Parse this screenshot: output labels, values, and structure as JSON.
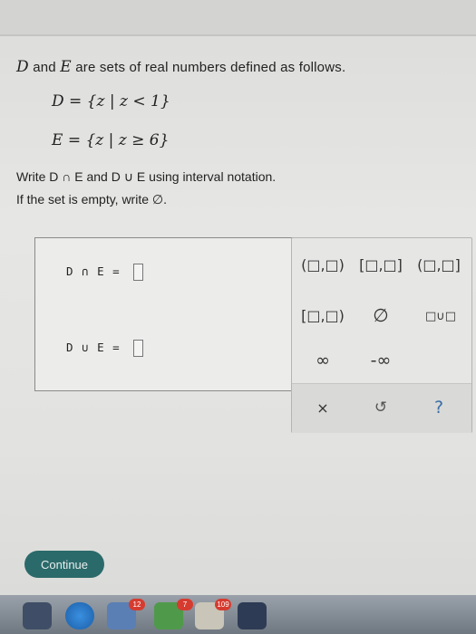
{
  "problem": {
    "intro_set1": "D",
    "intro_and": " and ",
    "intro_set2": "E",
    "intro_rest": " are sets of real numbers defined as follows.",
    "set_d": "D = {z | z < 1}",
    "set_e": "E = {z | z ≥ 6}",
    "instruction_1": "Write D ∩ E and D ∪ E using interval notation.",
    "instruction_2": "If the set is empty, write ∅."
  },
  "answers": {
    "intersection_label": "D ∩ E =",
    "union_label": "D ∪ E =",
    "intersection_value": "",
    "union_value": ""
  },
  "palette": {
    "open_open": "(□,□)",
    "closed_closed": "[□,□]",
    "open_closed": "(□,□]",
    "closed_open": "[□,□)",
    "empty_set": "∅",
    "union": "□∪□",
    "infinity": "∞",
    "neg_infinity": "-∞",
    "clear": "×",
    "undo": "↺",
    "help": "?"
  },
  "footer": {
    "continue_label": "Continue"
  },
  "taskbar": {
    "badge_1": "12",
    "badge_2": "7",
    "badge_3": "109"
  }
}
